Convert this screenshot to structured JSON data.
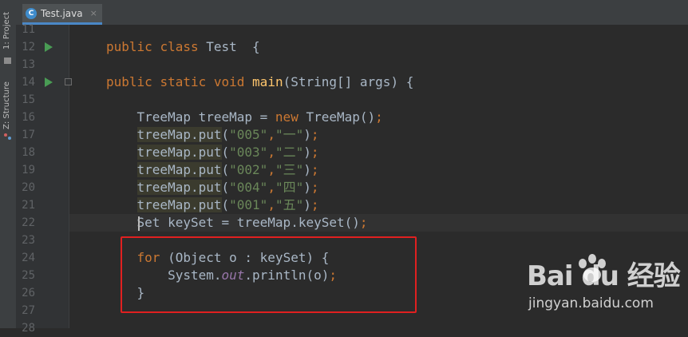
{
  "sidebar": {
    "project_label": "1: Project",
    "structure_label": "Z: Structure"
  },
  "tab": {
    "icon_letter": "C",
    "label": "Test.java",
    "close": "×"
  },
  "lines": [
    {
      "n": "11",
      "code": ""
    },
    {
      "n": "12",
      "code": "public class Test  {"
    },
    {
      "n": "13",
      "code": ""
    },
    {
      "n": "14",
      "code": "public static void main(String[] args) {"
    },
    {
      "n": "15",
      "code": ""
    },
    {
      "n": "16",
      "code": "    TreeMap treeMap = new TreeMap();"
    },
    {
      "n": "17",
      "code": "    treeMap.put(\"005\",\"一\");"
    },
    {
      "n": "18",
      "code": "    treeMap.put(\"003\",\"二\");"
    },
    {
      "n": "19",
      "code": "    treeMap.put(\"002\",\"三\");"
    },
    {
      "n": "20",
      "code": "    treeMap.put(\"004\",\"四\");"
    },
    {
      "n": "21",
      "code": "    treeMap.put(\"001\",\"五\");"
    },
    {
      "n": "22",
      "code": "    Set keySet = treeMap.keySet();"
    },
    {
      "n": "23",
      "code": ""
    },
    {
      "n": "24",
      "code": "    for (Object o : keySet) {"
    },
    {
      "n": "25",
      "code": "        System.out.println(o);"
    },
    {
      "n": "26",
      "code": "    }"
    },
    {
      "n": "27",
      "code": ""
    },
    {
      "n": "28",
      "code": ""
    }
  ],
  "watermark": {
    "brand": "Bai du 经验",
    "url": "jingyan.baidu.com"
  },
  "colors": {
    "keyword": "#cc7832",
    "method": "#ffc66d",
    "string": "#6a8759",
    "field": "#9876aa",
    "annotation_box": "#e02020"
  }
}
